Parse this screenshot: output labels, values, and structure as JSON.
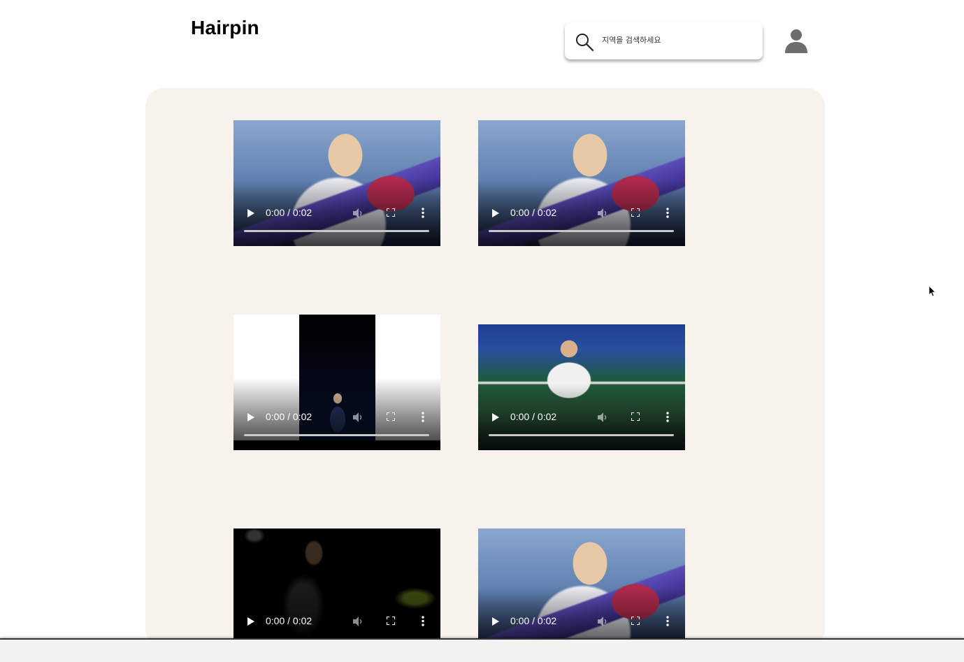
{
  "header": {
    "logo": "Hairpin",
    "search": {
      "placeholder": "지역을 검색하세요",
      "icon": "search-icon"
    },
    "profile_icon": "user-icon"
  },
  "videos": [
    {
      "scene": "medal-celebration",
      "time": "0:00 / 0:02"
    },
    {
      "scene": "medal-celebration",
      "time": "0:00 / 0:02"
    },
    {
      "scene": "vertical-overhead-shot",
      "time": "0:00 / 0:02"
    },
    {
      "scene": "net-smash",
      "time": "0:00 / 0:02"
    },
    {
      "scene": "blurred-dark-court",
      "time": "0:00 / 0:02"
    },
    {
      "scene": "medal-celebration",
      "time": "0:00 / 0:02"
    }
  ],
  "colors": {
    "panel": "#f7f3ec",
    "accent": "#000000"
  }
}
